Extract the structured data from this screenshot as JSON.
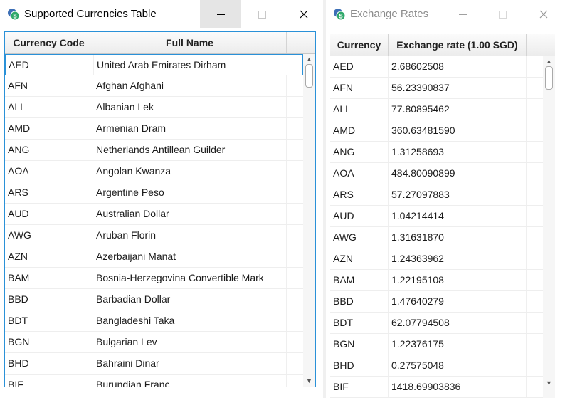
{
  "colors": {
    "accent": "#2a91d8",
    "coin_blue": "#3d6fb6",
    "coin_green": "#2fa86a"
  },
  "win1": {
    "title": "Supported Currencies Table",
    "icon": "currency-coin-icon",
    "columns": [
      "Currency Code",
      "Full Name"
    ],
    "rows": [
      [
        "AED",
        "United Arab Emirates Dirham"
      ],
      [
        "AFN",
        "Afghan Afghani"
      ],
      [
        "ALL",
        "Albanian Lek"
      ],
      [
        "AMD",
        "Armenian Dram"
      ],
      [
        "ANG",
        "Netherlands Antillean Guilder"
      ],
      [
        "AOA",
        "Angolan Kwanza"
      ],
      [
        "ARS",
        "Argentine Peso"
      ],
      [
        "AUD",
        "Australian Dollar"
      ],
      [
        "AWG",
        "Aruban Florin"
      ],
      [
        "AZN",
        "Azerbaijani Manat"
      ],
      [
        "BAM",
        "Bosnia-Herzegovina Convertible Mark"
      ],
      [
        "BBD",
        "Barbadian Dollar"
      ],
      [
        "BDT",
        "Bangladeshi Taka"
      ],
      [
        "BGN",
        "Bulgarian Lev"
      ],
      [
        "BHD",
        "Bahraini Dinar"
      ],
      [
        "BIF",
        "Burundian Franc"
      ]
    ],
    "selected_row": 0
  },
  "win2": {
    "title": "Exchange Rates",
    "icon": "currency-coin-icon",
    "columns": [
      "Currency",
      "Exchange rate (1.00 SGD)"
    ],
    "rows": [
      [
        "AED",
        "2.68602508"
      ],
      [
        "AFN",
        "56.23390837"
      ],
      [
        "ALL",
        "77.80895462"
      ],
      [
        "AMD",
        "360.63481590"
      ],
      [
        "ANG",
        "1.31258693"
      ],
      [
        "AOA",
        "484.80090899"
      ],
      [
        "ARS",
        "57.27097883"
      ],
      [
        "AUD",
        "1.04214414"
      ],
      [
        "AWG",
        "1.31631870"
      ],
      [
        "AZN",
        "1.24363962"
      ],
      [
        "BAM",
        "1.22195108"
      ],
      [
        "BBD",
        "1.47640279"
      ],
      [
        "BDT",
        "62.07794508"
      ],
      [
        "BGN",
        "1.22376175"
      ],
      [
        "BHD",
        "0.27575048"
      ],
      [
        "BIF",
        "1418.69903836"
      ]
    ]
  }
}
